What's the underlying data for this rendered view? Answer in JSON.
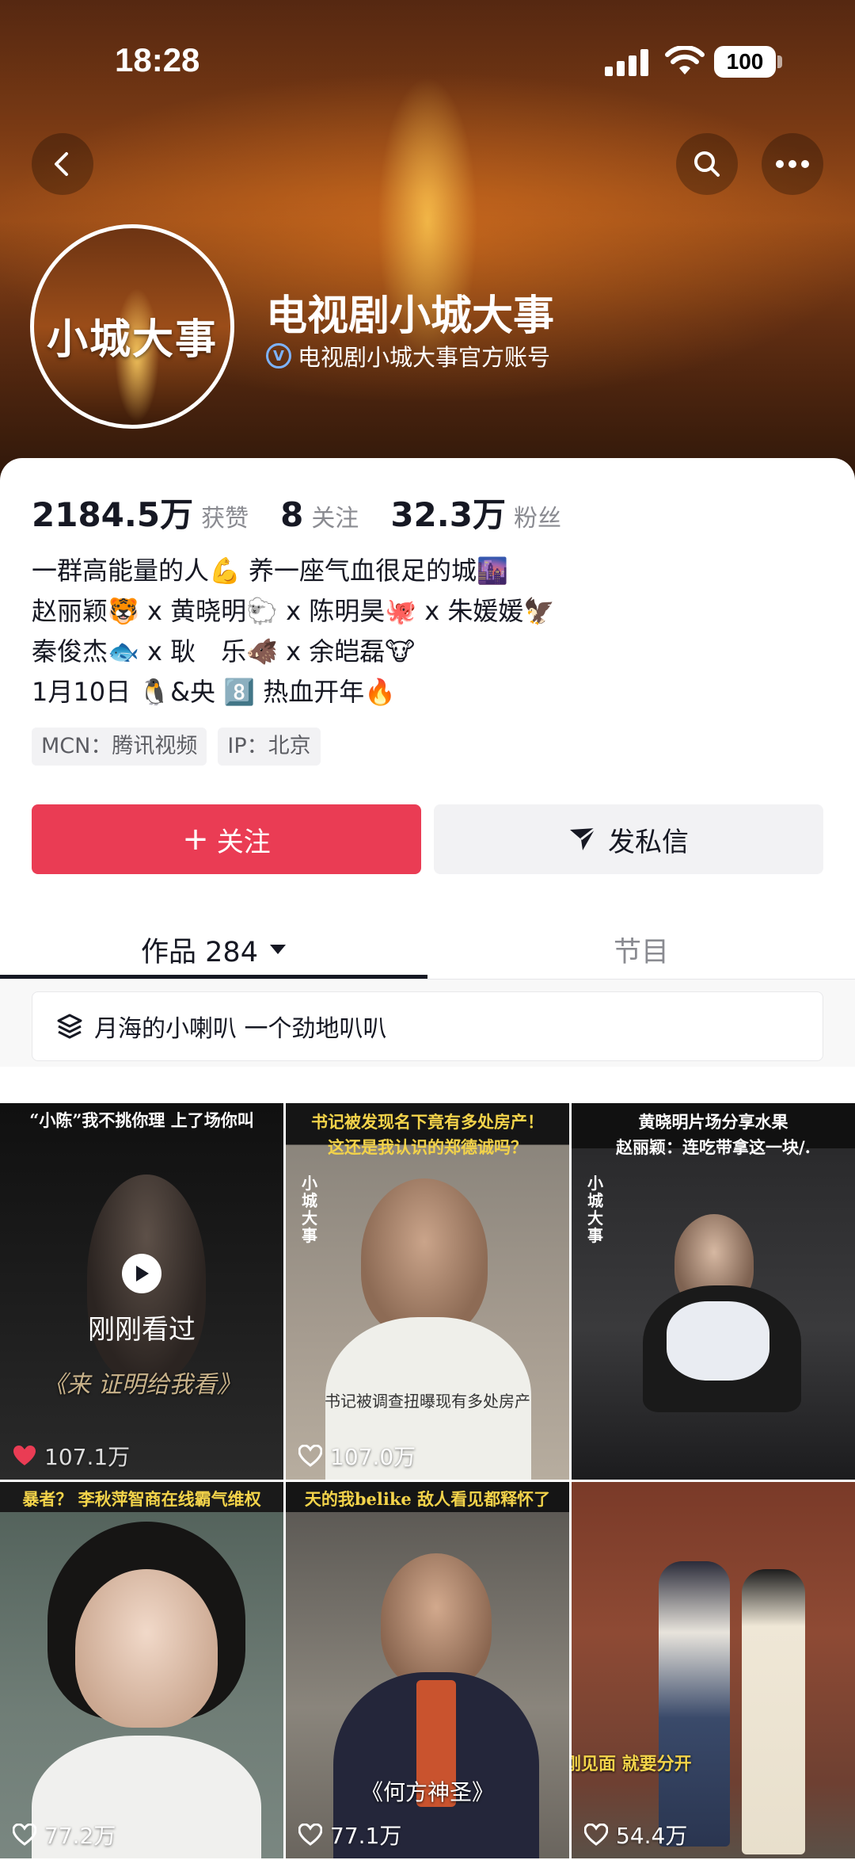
{
  "status": {
    "time": "18:28",
    "battery": "100"
  },
  "profile": {
    "name": "电视剧小城大事",
    "verified_text": "电视剧小城大事官方账号",
    "avatar_text": "小城大事"
  },
  "stats": [
    {
      "value": "2184.5万",
      "label": "获赞"
    },
    {
      "value": "8",
      "label": "关注"
    },
    {
      "value": "32.3万",
      "label": "粉丝"
    }
  ],
  "bio": [
    "一群高能量的人💪 养一座气血很足的城🌆",
    "赵丽颖🐯 x 黄晓明🐑 x 陈明昊🐙 x 朱媛媛🦅",
    "秦俊杰🐟 x 耿　乐🐗 x 余皑磊🐮",
    "1月10日 🐧&央 8️⃣ 热血开年🔥"
  ],
  "tags": [
    "MCN：腾讯视频",
    "IP：北京"
  ],
  "actions": {
    "follow": "关注",
    "follow_icon": "+",
    "message": "发私信"
  },
  "tabs": {
    "works": "作品 284",
    "program": "节目"
  },
  "collection": {
    "label": "月海的小喇叭 一个劲地叭叭"
  },
  "videos": [
    {
      "caption": "“小陈”我不挑你理 上了场你叫",
      "subtitle": "《来 证明给我看》",
      "likes": "107.1万",
      "watched": "刚刚看过",
      "liked": true
    },
    {
      "caption": "书记被发现名下竟有多处房产！\n这还是我认识的郑德诚吗？",
      "subtitle": "书记被调查扭曝现有多处房产",
      "likes": "107.0万",
      "liked": false,
      "brand": "小城大事"
    },
    {
      "caption": "黄晓明片场分享水果\n赵丽颖：连吃带拿这一块/.",
      "likes": "",
      "liked": false,
      "brand": "小城大事"
    },
    {
      "caption": "暴者？ 李秋萍智商在线霸气维权",
      "likes": "77.2万",
      "liked": false
    },
    {
      "caption": "天的我belike 敌人看见都释怀了",
      "subtitle": "《何方神圣》",
      "likes": "77.1万",
      "liked": false
    },
    {
      "caption": "",
      "subtitle": "刚见面 就要分开",
      "likes": "54.4万",
      "liked": false
    }
  ],
  "colors": {
    "accent": "#ea3c54",
    "caption": "#f3d34a",
    "verify": "#7db3ff"
  }
}
